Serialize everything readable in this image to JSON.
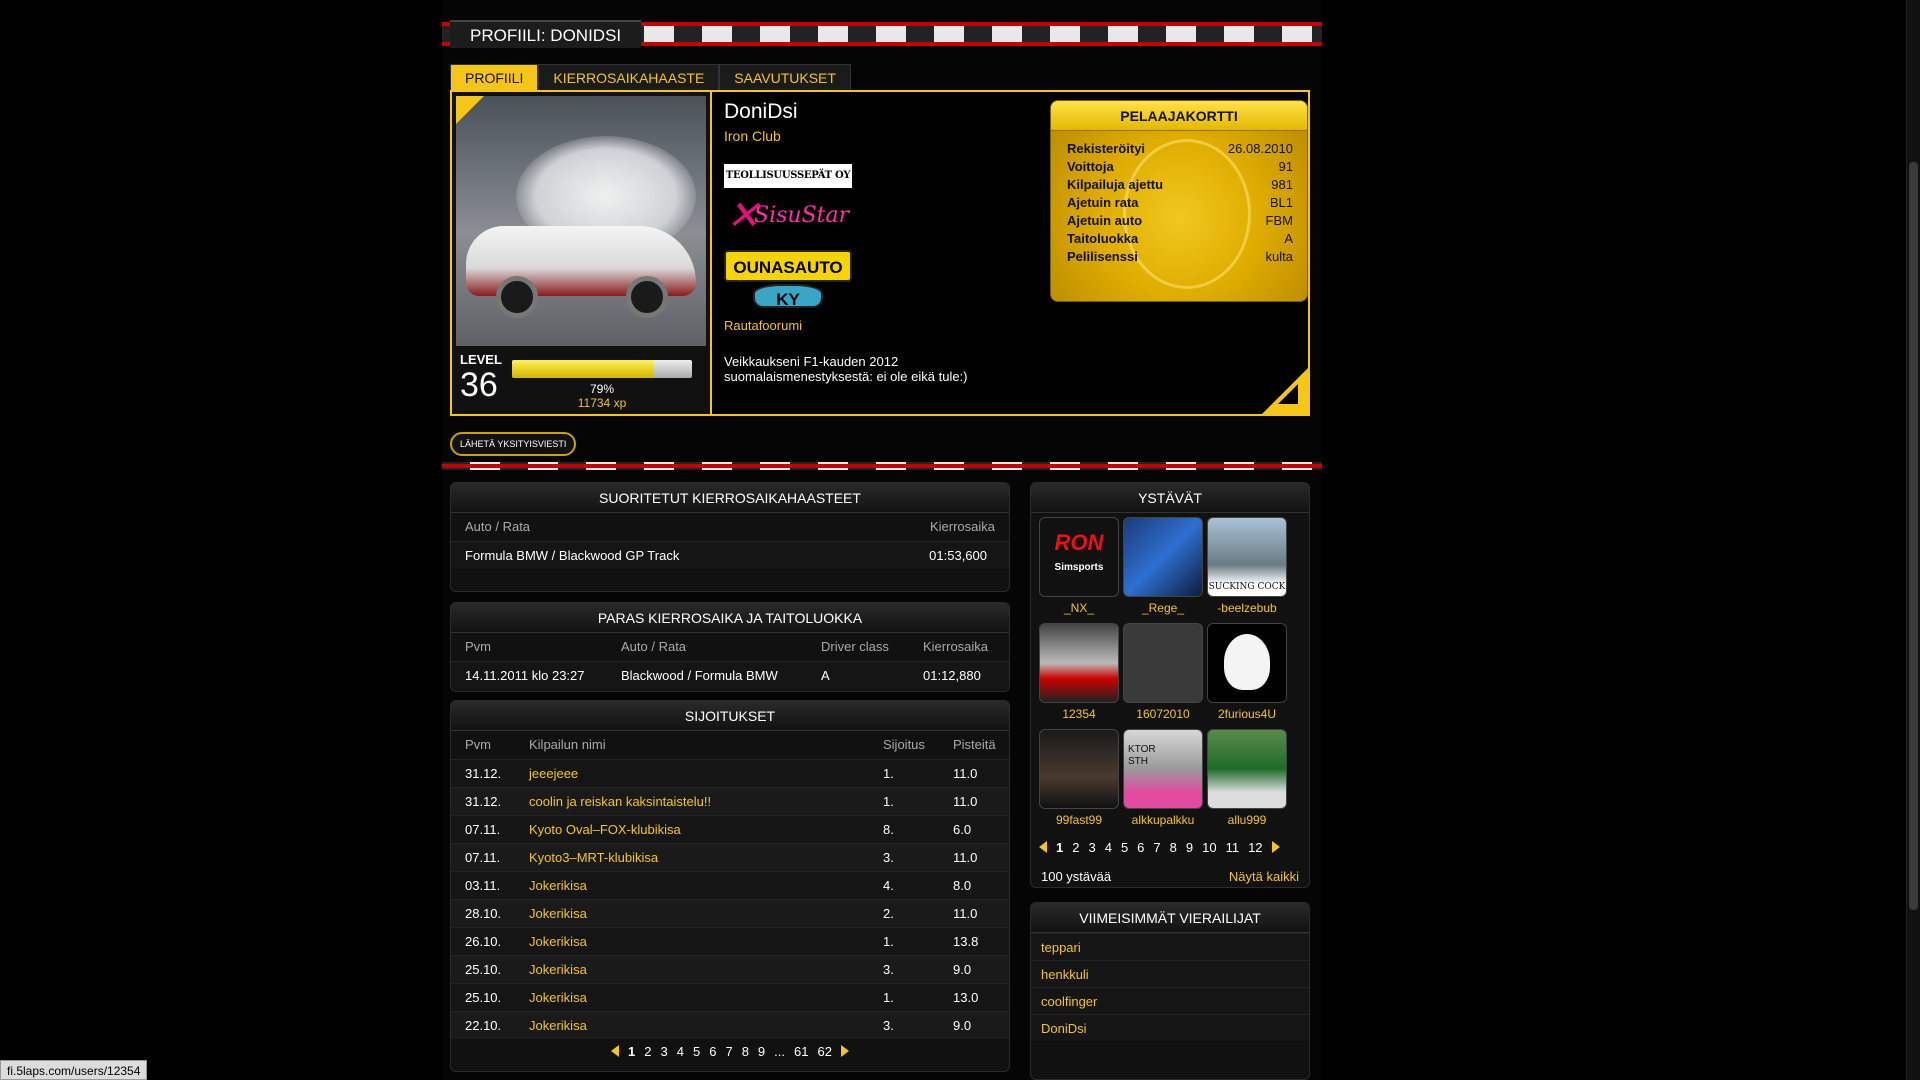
{
  "page_title": "PROFIILI: DONIDSI",
  "tabs": [
    "PROFIILI",
    "KIERROSAIKAHAASTE",
    "SAAVUTUKSET"
  ],
  "profile": {
    "name": "DoniDsi",
    "club": "Iron Club",
    "level_label": "LEVEL",
    "level": "36",
    "xp_percent": "79%",
    "xp_fill": 0.79,
    "xp": "11734 xp",
    "sponsors": [
      "TEOLLISUUSSEPÄT OY RAAHE",
      "SisuStar",
      "OUNASAUTO KY"
    ],
    "sponsor_link": "Rautafoorumi",
    "description_line1": "Veikkaukseni F1-kauden 2012",
    "description_line2": "suomalaismenestyksestä: ei ole eikä tule:)"
  },
  "player_card": {
    "title": "PELAAJAKORTTI",
    "rows": [
      {
        "k": "Rekisteröityi",
        "v": "26.08.2010"
      },
      {
        "k": "Voittoja",
        "v": "91"
      },
      {
        "k": "Kilpailuja ajettu",
        "v": "981"
      },
      {
        "k": "Ajetuin rata",
        "v": "BL1"
      },
      {
        "k": "Ajetuin auto",
        "v": "FBM"
      },
      {
        "k": "Taitoluokka",
        "v": "A"
      },
      {
        "k": "Pelilisenssi",
        "v": "kulta"
      }
    ]
  },
  "send_message_label": "LÄHETÄ YKSITYISVIESTI",
  "challenges": {
    "title": "SUORITETUT KIERROSAIKAHAASTEET",
    "headers": [
      "Auto / Rata",
      "Kierrosaika"
    ],
    "rows": [
      [
        "Formula BMW / Blackwood GP Track",
        "01:53,600"
      ]
    ]
  },
  "best_lap": {
    "title": "PARAS KIERROSAIKA JA TAITOLUOKKA",
    "headers": [
      "Pvm",
      "Auto / Rata",
      "Driver class",
      "Kierrosaika"
    ],
    "row": [
      "14.11.2011 klo 23:27",
      "Blackwood / Formula BMW",
      "A",
      "01:12,880"
    ]
  },
  "placements": {
    "title": "SIJOITUKSET",
    "headers": [
      "Pvm",
      "Kilpailun nimi",
      "Sijoitus",
      "Pisteitä"
    ],
    "rows": [
      [
        "31.12.",
        "jeeejeee",
        "1.",
        "11.0"
      ],
      [
        "31.12.",
        "coolin ja reiskan kaksintaistelu!!",
        "1.",
        "11.0"
      ],
      [
        "07.11.",
        "Kyoto Oval–FOX-klubikisa",
        "8.",
        "6.0"
      ],
      [
        "07.11.",
        "Kyoto3–MRT-klubikisa",
        "3.",
        "11.0"
      ],
      [
        "03.11.",
        "Jokerikisa",
        "4.",
        "8.0"
      ],
      [
        "28.10.",
        "Jokerikisa",
        "2.",
        "11.0"
      ],
      [
        "26.10.",
        "Jokerikisa",
        "1.",
        "13.8"
      ],
      [
        "25.10.",
        "Jokerikisa",
        "3.",
        "9.0"
      ],
      [
        "25.10.",
        "Jokerikisa",
        "1.",
        "13.0"
      ],
      [
        "22.10.",
        "Jokerikisa",
        "3.",
        "9.0"
      ]
    ],
    "pages": [
      "1",
      "2",
      "3",
      "4",
      "5",
      "6",
      "7",
      "8",
      "9",
      "...",
      "61",
      "62"
    ]
  },
  "friends": {
    "title": "YSTÄVÄT",
    "list": [
      "_NX_",
      "_Rege_",
      "-beelzebub",
      "12354",
      "16072010",
      "2furious4U",
      "99fast99",
      "alkkupalkku",
      "allu999"
    ],
    "pages": [
      "1",
      "2",
      "3",
      "4",
      "5",
      "6",
      "7",
      "8",
      "9",
      "10",
      "11",
      "12"
    ],
    "count": "100 ystävää",
    "show_all": "Näytä kaikki",
    "avatar_texts": {
      "ron": "RON",
      "simsports": "Simsports",
      "sucking": "SUCKING COCK",
      "ktor": "KTOR",
      "sth": "STH"
    }
  },
  "visitors": {
    "title": "VIIMEISIMMÄT VIERAILIJAT",
    "list": [
      "teppari",
      "henkkuli",
      "coolfinger",
      "DoniDsi"
    ]
  },
  "status_url": "fi.5laps.com/users/12354"
}
